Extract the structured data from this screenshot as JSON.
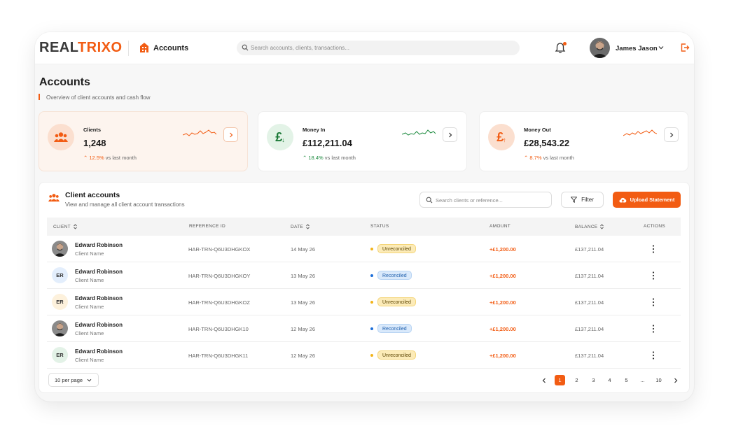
{
  "brand": {
    "logo_a": "REAL",
    "logo_b": "TRIXO"
  },
  "topbar": {
    "page_name": "Accounts",
    "search_placeholder": "Search accounts, clients, transactions...",
    "user_name": "James Jason"
  },
  "header": {
    "title": "Accounts",
    "subtitle": "Overview of client accounts and cash flow"
  },
  "cards": [
    {
      "label": "Clients",
      "value": "1,248",
      "trend_pct": "12.5%",
      "trend_text": "vs last month",
      "trend_color": "#f25c13"
    },
    {
      "label": "Money In",
      "value": "£112,211.04",
      "trend_pct": "18.4%",
      "trend_text": "vs last month",
      "trend_color": "#1c8a3e"
    },
    {
      "label": "Money Out",
      "value": "£28,543.22",
      "trend_pct": "8.7%",
      "trend_text": "vs last month",
      "trend_color": "#f25c13"
    }
  ],
  "table": {
    "title": "Client accounts",
    "subtitle": "View and manage all client account transactions",
    "search_placeholder": "Search clients or reference...",
    "filter_label": "Filter",
    "upload_label": "Upload Statement",
    "headers": {
      "client": "CLIENT",
      "reference": "REFERENCE ID",
      "date": "DATE",
      "status": "STATUS",
      "amount": "AMOUNT",
      "balance": "BALANCE",
      "actions": "ACTIONS"
    },
    "rows": [
      {
        "initials": "",
        "avatar": "photo",
        "name": "Edward Robinson",
        "sub": "Client Name",
        "ref": "HAR-TRN-Q6U3DHGKOX",
        "date": "14 May 26",
        "status": "Unreconciled",
        "amount": "+£1,200.00",
        "balance": "£137,211.04"
      },
      {
        "initials": "ER",
        "avatar": "blue",
        "name": "Edward Robinson",
        "sub": "Client Name",
        "ref": "HAR-TRN-Q6U3DHGKOY",
        "date": "13 May 26",
        "status": "Reconciled",
        "amount": "+£1,200.00",
        "balance": "£137,211.04"
      },
      {
        "initials": "ER",
        "avatar": "yel",
        "name": "Edward Robinson",
        "sub": "Client Name",
        "ref": "HAR-TRN-Q6U3DHGKOZ",
        "date": "13 May 26",
        "status": "Unreconciled",
        "amount": "+£1,200.00",
        "balance": "£137,211.04"
      },
      {
        "initials": "",
        "avatar": "photo",
        "name": "Edward Robinson",
        "sub": "Client Name",
        "ref": "HAR-TRN-Q6U3DHGK10",
        "date": "12 May 26",
        "status": "Reconciled",
        "amount": "+£1,200.00",
        "balance": "£137,211.04"
      },
      {
        "initials": "ER",
        "avatar": "grn",
        "name": "Edward Robinson",
        "sub": "Client Name",
        "ref": "HAR-TRN-Q6U3DHGK11",
        "date": "12 May 26",
        "status": "Unreconciled",
        "amount": "+£1,200.00",
        "balance": "£137,211.04"
      }
    ]
  },
  "pagination": {
    "per_page": "10 per page",
    "pages": [
      "1",
      "2",
      "3",
      "4",
      "5",
      "...",
      "10"
    ],
    "active": "1"
  },
  "colors": {
    "accent": "#f25c13",
    "positive": "#1c8a3e",
    "reconciled": "#1e6fd9",
    "unreconciled": "#f2b41c"
  }
}
